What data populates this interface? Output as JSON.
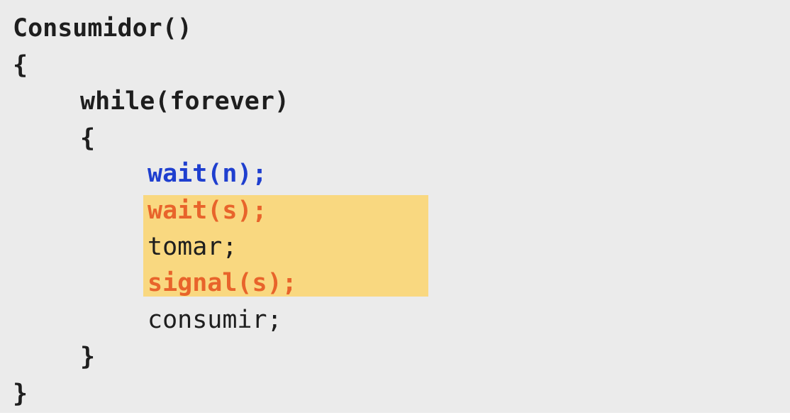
{
  "code": {
    "function_signature": "Consumidor()",
    "open_brace_outer": "{",
    "while_statement": "while(forever)",
    "open_brace_inner": "{",
    "wait_n": "wait(n);",
    "wait_s": "wait(s);",
    "tomar": "tomar;",
    "signal_s": "signal(s);",
    "consumir": "consumir;",
    "close_brace_inner": "}",
    "close_brace_outer": "}"
  },
  "colors": {
    "panel_background": "#ebebeb",
    "critical_section_highlight": "#f9d880",
    "wait_n_color": "#1f3fcf",
    "semaphore_s_color": "#e8642b",
    "default_text": "#1e1e1e"
  }
}
